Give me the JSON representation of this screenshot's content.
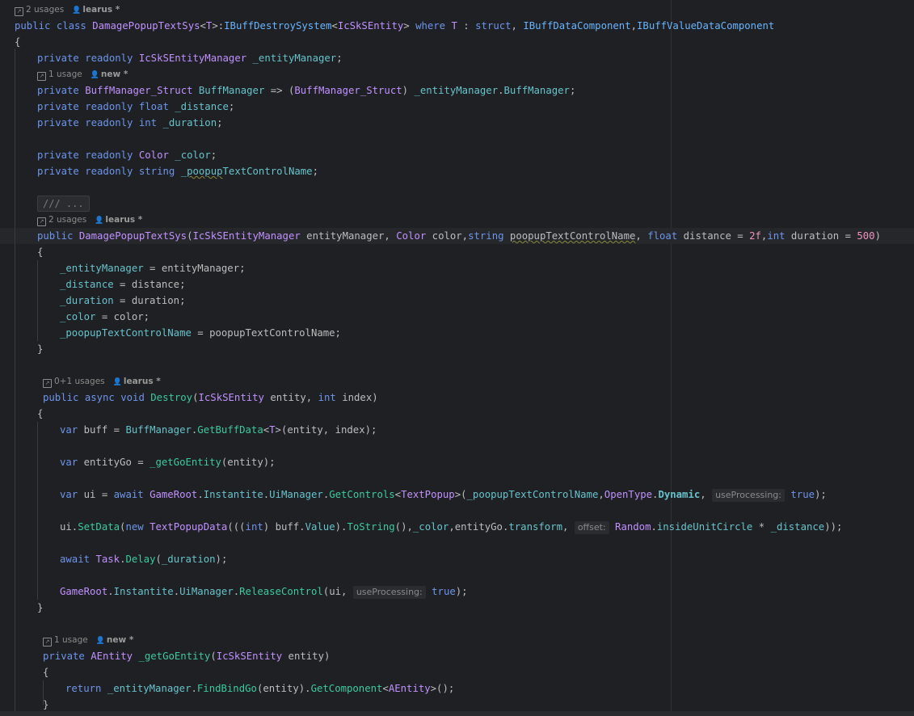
{
  "code": {
    "class_usages": "2 usages",
    "class_author": "learus *",
    "entity_mgr_usages": "1 usage",
    "entity_mgr_author": "new *",
    "ctor_usages": "2 usages",
    "ctor_author": "learus *",
    "destroy_usages": "0+1 usages",
    "destroy_author": "learus *",
    "getgo_usages": "1 usage",
    "getgo_author": "new *",
    "folded_comment": "///  ...",
    "hint_useProcessing": "useProcessing:",
    "hint_offset": "offset:"
  }
}
